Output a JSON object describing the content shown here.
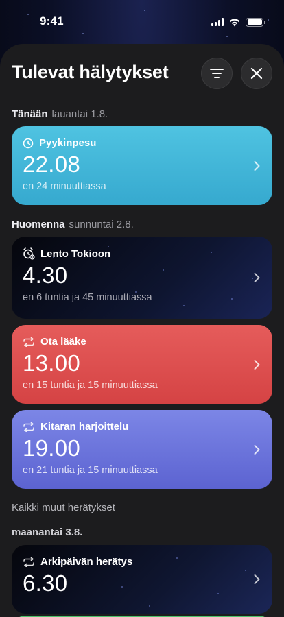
{
  "status_bar": {
    "time": "9:41"
  },
  "sheet": {
    "title": "Tulevat hälytykset",
    "today_label": "Tänään",
    "today_date": "lauantai 1.8.",
    "tomorrow_label": "Huomenna",
    "tomorrow_date": "sunnuntai 2.8.",
    "others_label": "Kaikki muut herätykset",
    "monday_label": "maanantai 3.8."
  },
  "alarms": [
    {
      "name": "Pyykinpesu",
      "time": "22.08",
      "relative": "en 24 minuuttiassa",
      "icon": "clock-icon"
    },
    {
      "name": "Lento Tokioon",
      "time": "4.30",
      "relative": "en 6 tuntia ja 45 minuuttiassa",
      "icon": "alarm-clock-icon"
    },
    {
      "name": "Ota lääke",
      "time": "13.00",
      "relative": "en 15 tuntia ja 15 minuuttiassa",
      "icon": "repeat-icon"
    },
    {
      "name": "Kitaran harjoittelu",
      "time": "19.00",
      "relative": "en 21 tuntia ja 15 minuuttiassa",
      "icon": "repeat-icon"
    },
    {
      "name": "Arkipäivän herätys",
      "time": "6.30",
      "relative": "",
      "icon": "repeat-icon"
    }
  ],
  "colors": {
    "cyan": "#4fc3e1",
    "red": "#e55c5b",
    "violet": "#7c86e6",
    "green": "#4cbf6b",
    "sheet": "#1c1c1e"
  }
}
